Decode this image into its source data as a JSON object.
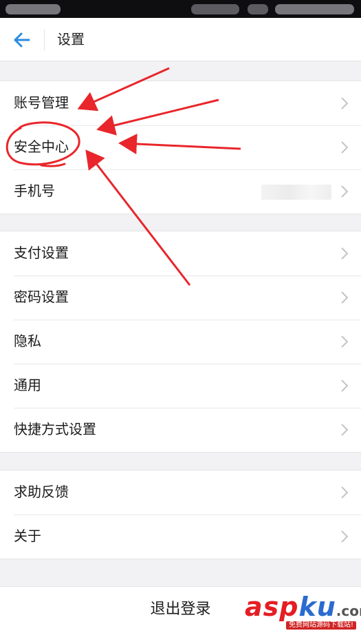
{
  "nav": {
    "title": "设置",
    "back_icon": "arrow-left-icon"
  },
  "groups": [
    {
      "rows": [
        {
          "label": "账号管理"
        },
        {
          "label": "安全中心"
        },
        {
          "label": "手机号"
        }
      ]
    },
    {
      "rows": [
        {
          "label": "支付设置"
        },
        {
          "label": "密码设置"
        },
        {
          "label": "隐私"
        },
        {
          "label": "通用"
        },
        {
          "label": "快捷方式设置"
        }
      ]
    },
    {
      "rows": [
        {
          "label": "求助反馈"
        },
        {
          "label": "关于"
        }
      ]
    }
  ],
  "logout": {
    "label": "退出登录"
  },
  "watermark": {
    "logo_a": "asp",
    "logo_b": "ku",
    "logo_c": ".com",
    "subtitle": "免费网站源码下载站!"
  },
  "colors": {
    "accent": "#2b8ae0",
    "annotation": "#e8262b",
    "page_bg": "#f2f2f4",
    "status_bar": "#0e0e10"
  }
}
